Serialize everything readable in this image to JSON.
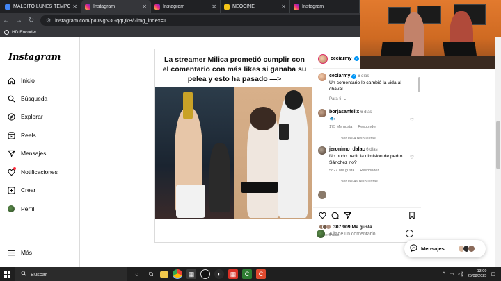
{
  "browser": {
    "tabs": [
      {
        "label": "MALDITO LUNES TEMPORA",
        "icon": "document-icon",
        "color": "#4285f4",
        "active": false
      },
      {
        "label": "Instagram",
        "icon": "instagram-icon",
        "color": "#e1306c",
        "active": true
      },
      {
        "label": "Instagram",
        "icon": "instagram-icon",
        "color": "#e1306c",
        "active": false
      },
      {
        "label": "NEOCINE",
        "icon": "neocine-icon",
        "color": "#f5c518",
        "active": false
      },
      {
        "label": "Instagram",
        "icon": "instagram-icon",
        "color": "#e1306c",
        "active": false
      }
    ],
    "url": "instagram.com/p/DNgN3GqqQkB/?img_index=1",
    "bookmark_label": "HD Encoder"
  },
  "instagram": {
    "logo": "Instagram",
    "nav": [
      {
        "label": "Inicio",
        "icon": "home-icon"
      },
      {
        "label": "Búsqueda",
        "icon": "search-icon"
      },
      {
        "label": "Explorar",
        "icon": "compass-icon"
      },
      {
        "label": "Reels",
        "icon": "reels-icon"
      },
      {
        "label": "Mensajes",
        "icon": "send-icon"
      },
      {
        "label": "Notificaciones",
        "icon": "heart-icon"
      },
      {
        "label": "Crear",
        "icon": "plus-icon"
      },
      {
        "label": "Perfil",
        "icon": "profile-avatar-icon"
      }
    ],
    "more_label": "Más"
  },
  "post": {
    "headline": "La streamer Milica prometió cumplir con el comentario con más likes si ganaba su pelea y esto ha pasado —>",
    "author": "ceciarmy",
    "caption_author": "ceciarmy",
    "caption_time": "6 días",
    "caption_text": "Un comentario le cambió la vida al chaval",
    "see_translation": "Para ti",
    "comments": [
      {
        "user": "borjasanfelix",
        "time": "6 días",
        "text": "🐟",
        "likes": "175 Me gusta",
        "reply": "Responder",
        "replies_label": "Ver las 4 respuestas"
      },
      {
        "user": "jeronimo_dalac",
        "time": "6 días",
        "text": "No pudo pedir la dimisión de pedro Sánchez no?",
        "likes": "5827 Me gusta",
        "reply": "Responder",
        "replies_label": "Ver las 46 respuestas"
      }
    ],
    "likes_count": "307 909 Me gusta",
    "date": "Hace 6 días",
    "add_comment_placeholder": "Añade un comentario..."
  },
  "messages_pill": {
    "label": "Mensajes"
  },
  "taskbar": {
    "search_label": "Buscar",
    "time": "13:09",
    "date": "25/08/2025"
  }
}
